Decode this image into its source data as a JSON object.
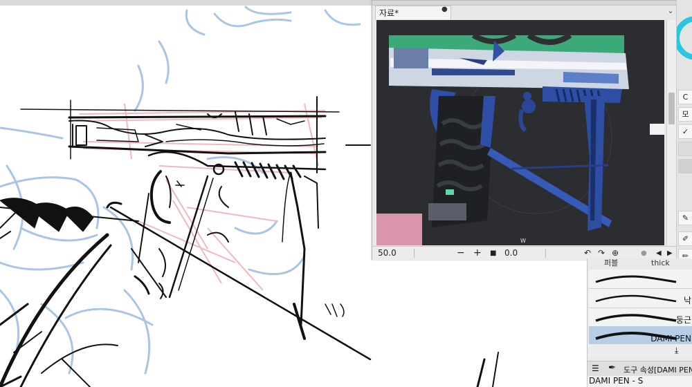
{
  "reference_window": {
    "tab_title": "자료*",
    "tab_modified_icon": "●",
    "menu_icon": "chevron-down-icon",
    "status": {
      "zoom": "50.0",
      "zoom_out": "−",
      "zoom_in": "+",
      "square": "■",
      "rotation": "0.0",
      "rotate_ccw": "↶",
      "rotate_cw": "↷",
      "rotate_reset": "⊕",
      "scroll_left": "◀",
      "scroll_right": "▶"
    },
    "image_watermark": "W"
  },
  "brush_panel": {
    "tabs": [
      "퍼블",
      "thick"
    ],
    "brushes": [
      {
        "label": ""
      },
      {
        "label": "낙"
      },
      {
        "label": "둥근"
      },
      {
        "label": "DAMI PEN"
      }
    ]
  },
  "tool_property": {
    "title": "도구 속성[DAMI PEN",
    "sub_label": "DAMI PEN - S"
  },
  "tool_column": {
    "labels": [
      "C",
      "모"
    ]
  },
  "colors": {
    "accent_selected": "#b8cde6",
    "canvas_blue_sketch": "#a9c5e6",
    "canvas_red_sketch": "#f0b8bc",
    "ink": "#111111"
  }
}
